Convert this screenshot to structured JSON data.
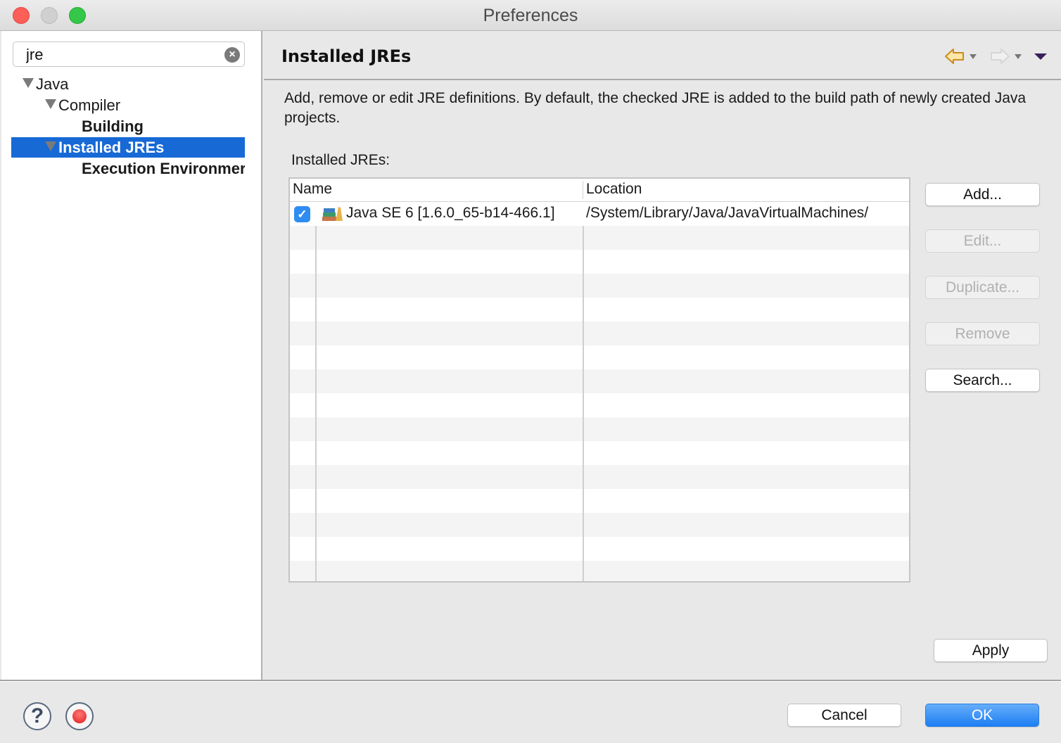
{
  "window": {
    "title": "Preferences"
  },
  "sidebar": {
    "filter_value": "jre",
    "filter_clear_icon": "clear-icon",
    "tree": [
      {
        "label": "Java",
        "expanded": true,
        "level": 0,
        "bold": false,
        "selected": false
      },
      {
        "label": "Compiler",
        "expanded": true,
        "level": 1,
        "bold": false,
        "selected": false
      },
      {
        "label": "Building",
        "level": 2,
        "bold": true,
        "selected": false
      },
      {
        "label": "Installed JREs",
        "expanded": true,
        "level": 1,
        "bold": true,
        "selected": true
      },
      {
        "label": "Execution Environmer",
        "level": 2,
        "bold": true,
        "selected": false
      }
    ]
  },
  "page": {
    "title": "Installed JREs",
    "nav": {
      "back_icon": "back-arrow-icon",
      "forward_icon": "forward-arrow-icon",
      "menu_icon": "view-menu-icon"
    },
    "description": "Add, remove or edit JRE definitions. By default, the checked JRE is added to the build path of newly created Java projects.",
    "table_label": "Installed JREs:",
    "table": {
      "columns": [
        "Name",
        "Location"
      ],
      "rows": [
        {
          "checked": true,
          "icon": "jre-library-icon",
          "name": "Java SE 6 [1.6.0_65-b14-466.1]",
          "location": "/System/Library/Java/JavaVirtualMachines/"
        }
      ]
    },
    "buttons": {
      "add": "Add...",
      "edit": "Edit...",
      "duplicate": "Duplicate...",
      "remove": "Remove",
      "search": "Search...",
      "apply": "Apply"
    }
  },
  "footer": {
    "help_icon": "help-icon",
    "stop_icon": "stop-icon",
    "cancel": "Cancel",
    "ok": "OK"
  },
  "colors": {
    "selection": "#1769d6",
    "primary_button": "#1d7ef3",
    "checkbox": "#2f8cf2"
  }
}
